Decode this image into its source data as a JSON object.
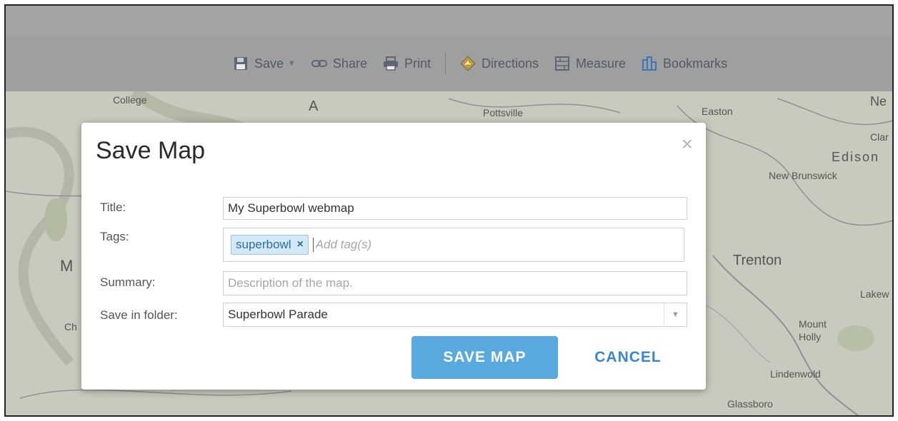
{
  "toolbar": {
    "save_label": "Save",
    "share_label": "Share",
    "print_label": "Print",
    "directions_label": "Directions",
    "measure_label": "Measure",
    "bookmarks_label": "Bookmarks"
  },
  "map": {
    "places": [
      "College",
      "A",
      "Pottsville",
      "Easton",
      "Ne",
      "Clar",
      "Edison",
      "New Brunswick",
      "M",
      "Trenton",
      "Lakew",
      "Ch",
      "Mount",
      "Holly",
      "Lindenwold",
      "Glassboro"
    ]
  },
  "dialog": {
    "title": "Save Map",
    "close_glyph": "×",
    "title_label": "Title:",
    "title_value": "My Superbowl webmap",
    "tags_label": "Tags:",
    "tags": [
      "superbowl"
    ],
    "tag_remove_glyph": "×",
    "tags_placeholder": "Add tag(s)",
    "summary_label": "Summary:",
    "summary_placeholder": "Description of the map.",
    "folder_label": "Save in folder:",
    "folder_value": "Superbowl Parade",
    "save_button": "SAVE MAP",
    "cancel_button": "CANCEL"
  },
  "colors": {
    "accent": "#5aa9de",
    "link": "#3b87c7",
    "toolbar_bg": "#9f9f9f"
  }
}
